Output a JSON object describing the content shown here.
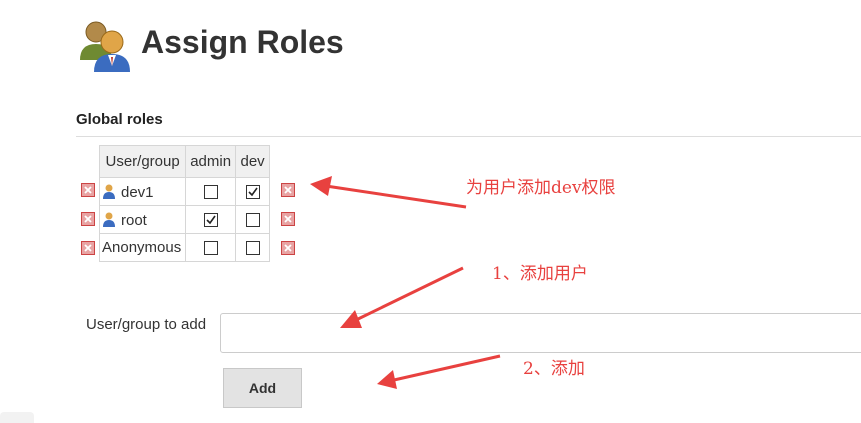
{
  "header": {
    "title": "Assign Roles",
    "icon": "users-icon"
  },
  "global_roles": {
    "section_title": "Global roles",
    "columns": [
      "User/group",
      "admin",
      "dev"
    ],
    "rows": [
      {
        "name": "dev1",
        "icon": "user-icon",
        "admin": false,
        "dev": true
      },
      {
        "name": "root",
        "icon": "user-icon",
        "admin": true,
        "dev": false
      },
      {
        "name": "Anonymous",
        "icon": "",
        "admin": false,
        "dev": false
      }
    ]
  },
  "add_form": {
    "label": "User/group to add",
    "value": "",
    "placeholder": "",
    "button_label": "Add"
  },
  "annotations": [
    "为用户添加dev权限",
    "1、添加用户",
    "2、添加"
  ],
  "colors": {
    "annotation_red": "#e8413f",
    "delete_red": "#cc4444"
  }
}
